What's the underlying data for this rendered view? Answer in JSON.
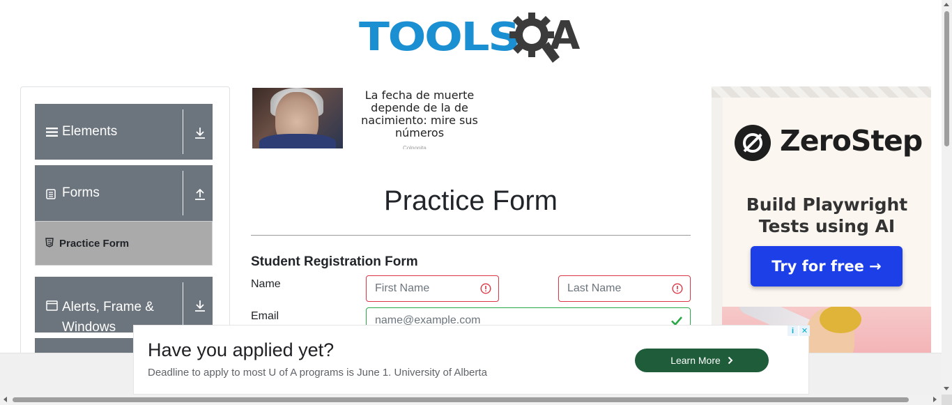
{
  "header": {
    "logo_text": "TOOLS",
    "logo_suffix": "A"
  },
  "sidebar": {
    "groups": [
      {
        "label": "Elements",
        "icon": "hamburger-icon",
        "arrow": "download-arrow-icon"
      },
      {
        "label": "Forms",
        "icon": "document-icon",
        "arrow": "upload-arrow-icon"
      },
      {
        "label": "Alerts, Frame & Windows",
        "icon": "window-icon",
        "arrow": "download-arrow-icon"
      }
    ],
    "active_item": {
      "label": "Practice Form",
      "icon": "html5-icon"
    }
  },
  "top_ad": {
    "text": "La fecha de muerte depende de la de nacimiento: mire sus números",
    "source": "Colpopita"
  },
  "main": {
    "title": "Practice Form",
    "heading": "Student Registration Form",
    "fields": {
      "name_label": "Name",
      "first_name_placeholder": "First Name",
      "last_name_placeholder": "Last Name",
      "email_label": "Email",
      "email_placeholder": "name@example.com"
    }
  },
  "right_ad": {
    "brand": "ZeroStep",
    "tagline_line1": "Build Playwright",
    "tagline_line2": "Tests using AI",
    "cta": "Try for free →",
    "button_color": "#1d3fe8"
  },
  "bottom_ad": {
    "title": "Have you applied yet?",
    "subtitle": "Deadline to apply to most U of A programs is June 1. University of Alberta",
    "cta": "Learn More",
    "button_color": "#1e5c3a"
  },
  "colors": {
    "sidebar_group": "#6c757d",
    "active_item": "#aaaaaa",
    "invalid_border": "#dc3545",
    "valid_border": "#28a745",
    "logo_blue": "#1a8fd1"
  }
}
